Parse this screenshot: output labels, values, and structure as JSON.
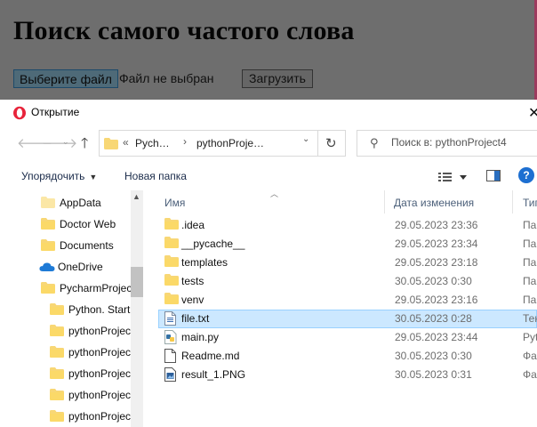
{
  "page": {
    "title": "Поиск самого частого слова",
    "choose_file_label": "Выберите файл",
    "no_file_text": "Файл не выбран",
    "upload_label": "Загрузить"
  },
  "dialog": {
    "title": "Открытие",
    "breadcrumb": [
      "«",
      "Pych…",
      "pythonProje…"
    ],
    "search_placeholder": "Поиск в: pythonProject4",
    "toolbar": {
      "organize_label": "Упорядочить",
      "new_folder_label": "Новая папка",
      "help_label": "?"
    },
    "nav_items": [
      {
        "label": "AppData",
        "icon": "folder-light-icon"
      },
      {
        "label": "Doctor Web",
        "icon": "folder-icon"
      },
      {
        "label": "Documents",
        "icon": "folder-icon"
      },
      {
        "label": "OneDrive",
        "icon": "cloud-icon"
      },
      {
        "label": "PycharmProjec",
        "icon": "folder-icon"
      },
      {
        "label": "Python. Start",
        "icon": "folder-icon"
      },
      {
        "label": "pythonProjec",
        "icon": "folder-icon"
      },
      {
        "label": "pythonProjec",
        "icon": "folder-icon"
      },
      {
        "label": "pythonProjec",
        "icon": "folder-icon"
      },
      {
        "label": "pythonProjec",
        "icon": "folder-icon"
      },
      {
        "label": "pythonProjec",
        "icon": "folder-icon"
      }
    ],
    "columns": {
      "name": "Имя",
      "date": "Дата изменения",
      "type": "Тип"
    },
    "files": [
      {
        "name": ".idea",
        "date": "29.05.2023 23:36",
        "type": "Па",
        "icon": "folder-icon",
        "selected": false
      },
      {
        "name": "__pycache__",
        "date": "29.05.2023 23:34",
        "type": "Па",
        "icon": "folder-icon",
        "selected": false
      },
      {
        "name": "templates",
        "date": "29.05.2023 23:18",
        "type": "Па",
        "icon": "folder-icon",
        "selected": false
      },
      {
        "name": "tests",
        "date": "30.05.2023 0:30",
        "type": "Па",
        "icon": "folder-icon",
        "selected": false
      },
      {
        "name": "venv",
        "date": "29.05.2023 23:16",
        "type": "Па",
        "icon": "folder-icon",
        "selected": false
      },
      {
        "name": "file.txt",
        "date": "30.05.2023 0:28",
        "type": "Тек",
        "icon": "text-file-icon",
        "selected": true
      },
      {
        "name": "main.py",
        "date": "29.05.2023 23:44",
        "type": "Pyt",
        "icon": "python-file-icon",
        "selected": false
      },
      {
        "name": "Readme.md",
        "date": "30.05.2023 0:30",
        "type": "Фа",
        "icon": "document-icon",
        "selected": false
      },
      {
        "name": "result_1.PNG",
        "date": "30.05.2023 0:31",
        "type": "Фа",
        "icon": "image-file-icon",
        "selected": false
      }
    ],
    "colors": {
      "folder": "#f8d775",
      "selection": "#cce8ff",
      "link": "#1a2b4a"
    }
  }
}
